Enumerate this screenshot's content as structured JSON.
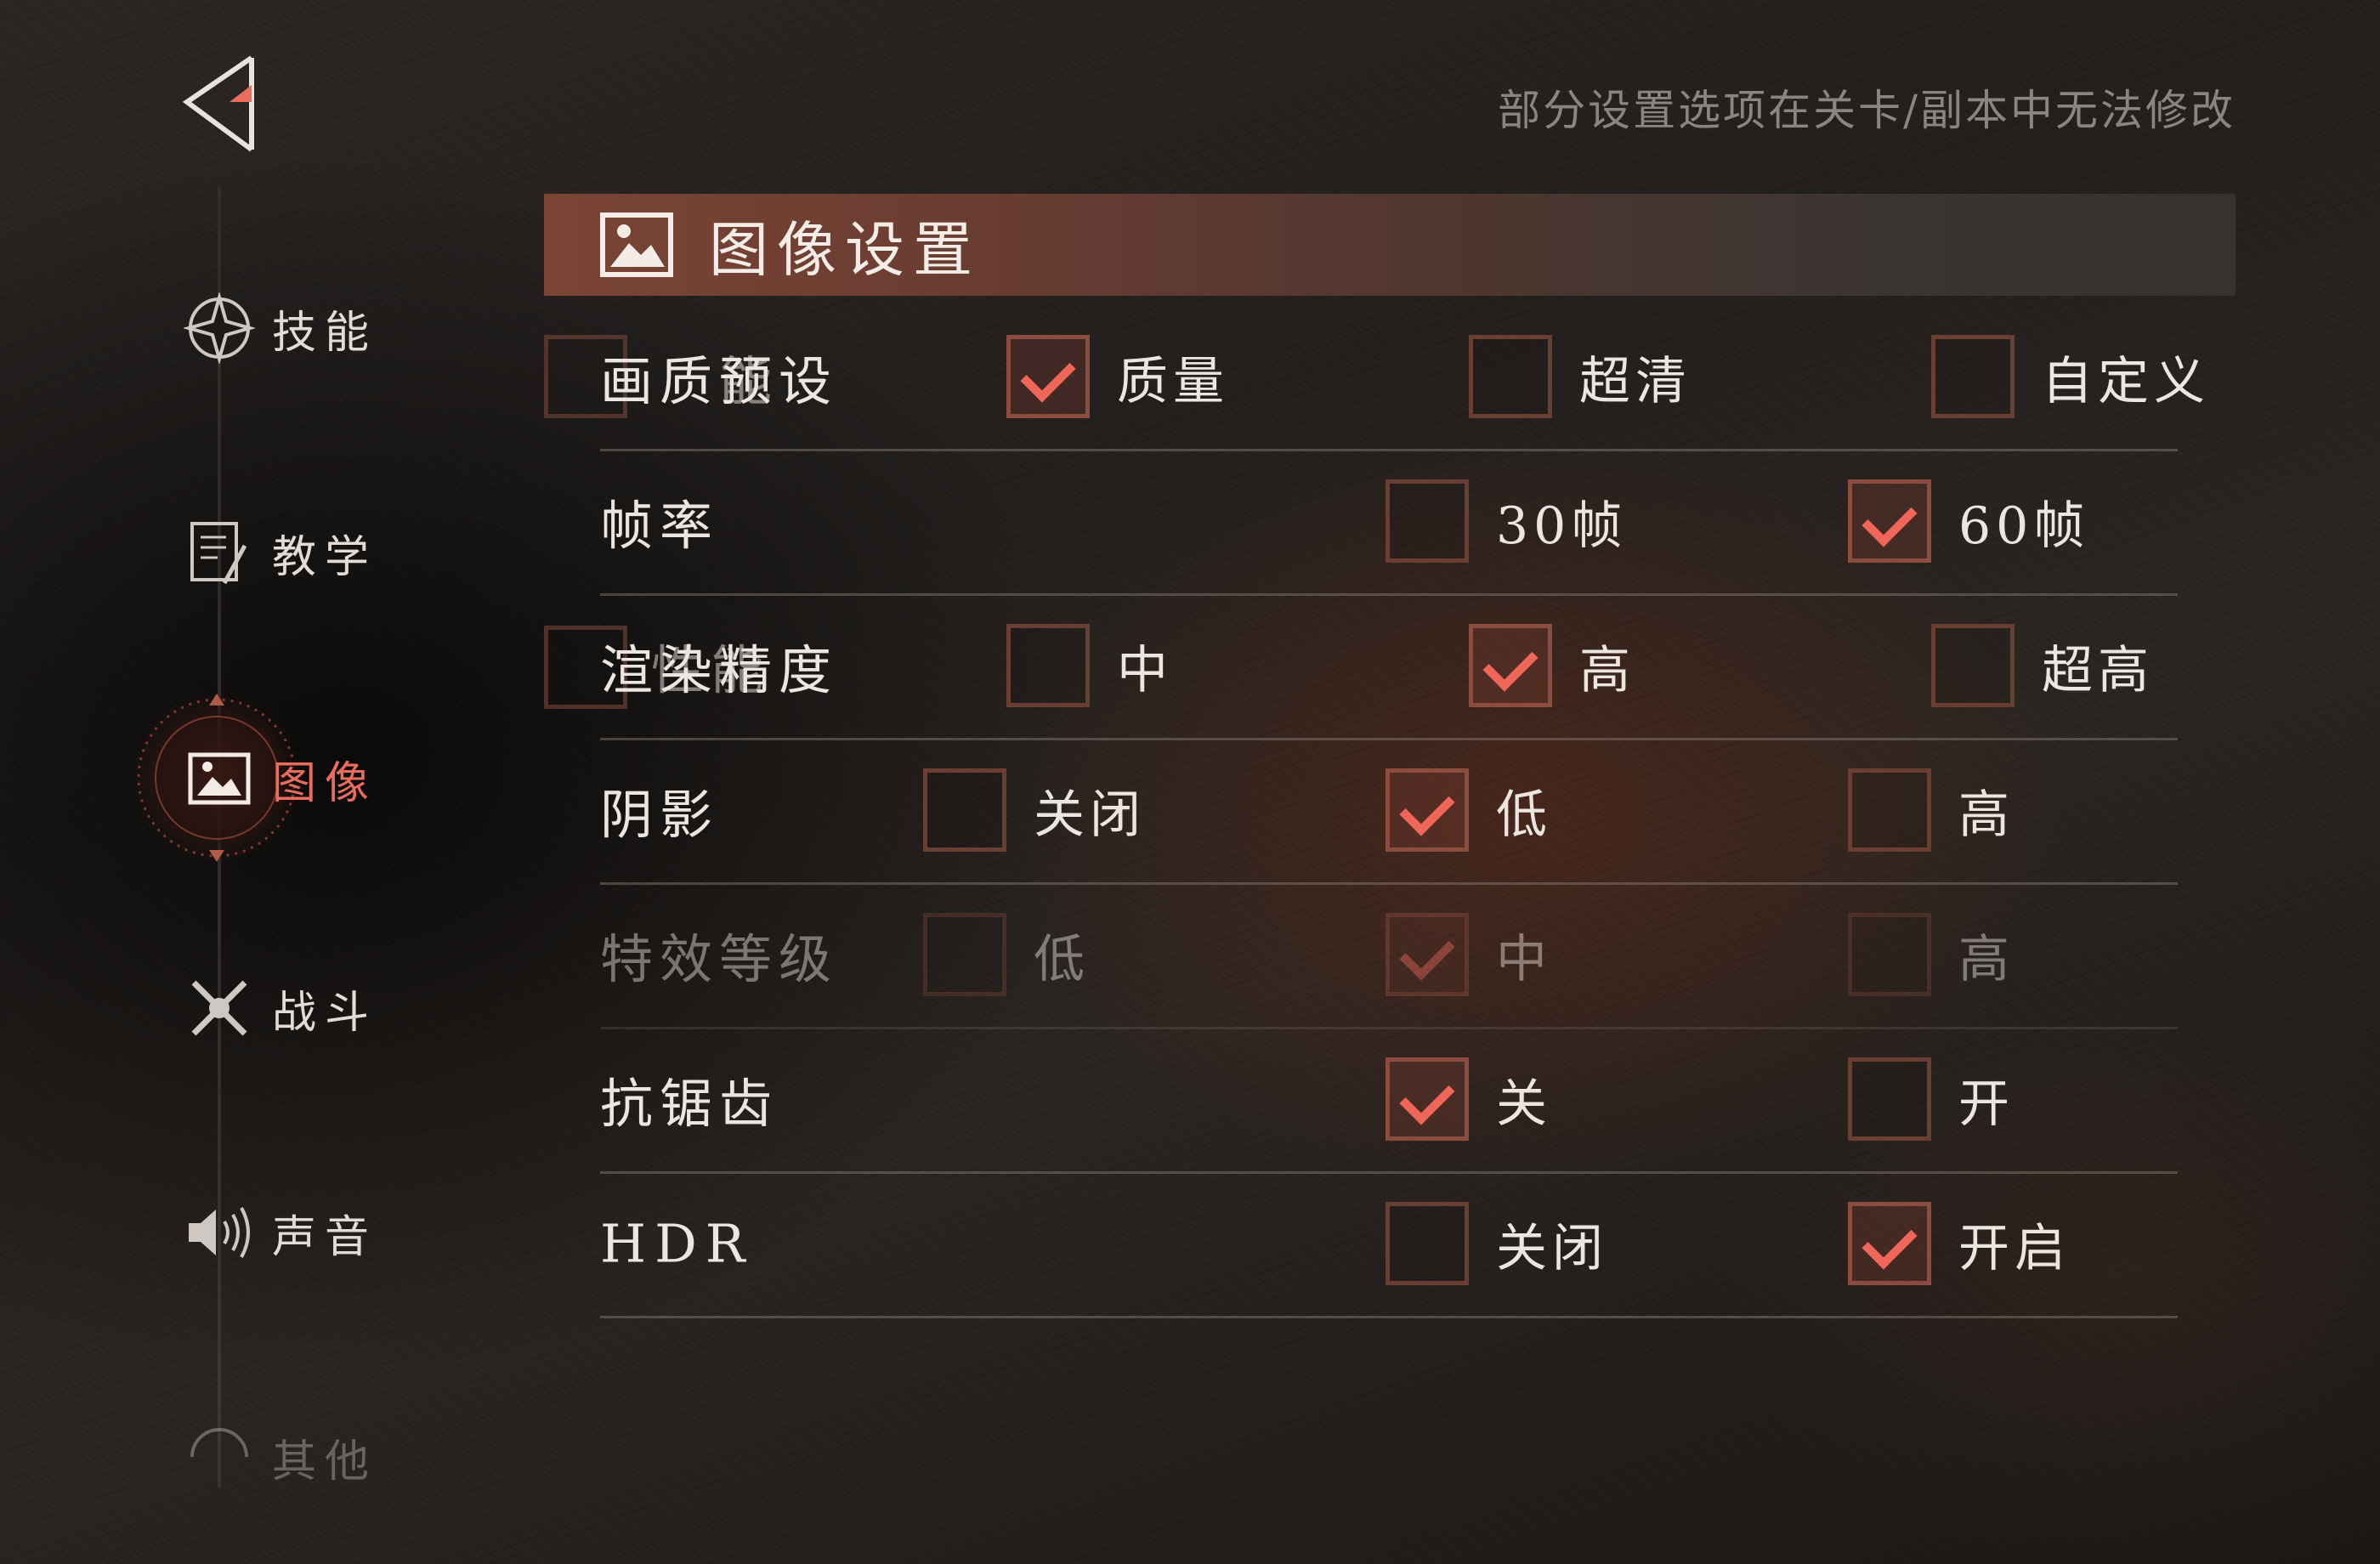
{
  "notice": "部分设置选项在关卡/副本中无法修改",
  "section": {
    "title": "图像设置",
    "icon": "image-icon"
  },
  "sidebar": {
    "items": [
      {
        "label": "技能",
        "icon": "compass-star-icon",
        "active": false
      },
      {
        "label": "教学",
        "icon": "notebook-pen-icon",
        "active": false
      },
      {
        "label": "图像",
        "icon": "image-icon",
        "active": true
      },
      {
        "label": "战斗",
        "icon": "crossed-swords-icon",
        "active": false
      },
      {
        "label": "声音",
        "icon": "speaker-icon",
        "active": false
      },
      {
        "label": "其他",
        "icon": "circle-icon",
        "active": false
      }
    ]
  },
  "colors": {
    "accent": "#e96c5c",
    "checkbox_border": "#6b3e33",
    "header_start": "#7a4434"
  },
  "settings": [
    {
      "label": "画质预设",
      "overlay": "质能",
      "options": [
        {
          "label": "质量",
          "checked": true
        },
        {
          "label": "超清",
          "checked": false
        },
        {
          "label": "自定义",
          "checked": false
        }
      ]
    },
    {
      "label": "帧率",
      "options": [
        {
          "label": "30帧",
          "checked": false
        },
        {
          "label": "60帧",
          "checked": true
        }
      ]
    },
    {
      "label": "渲染精度",
      "overlay": "性能",
      "options": [
        {
          "label": "中",
          "checked": false
        },
        {
          "label": "高",
          "checked": true
        },
        {
          "label": "超高",
          "checked": false
        }
      ]
    },
    {
      "label": "阴影",
      "options": [
        {
          "label": "关闭",
          "checked": false
        },
        {
          "label": "低",
          "checked": true
        },
        {
          "label": "高",
          "checked": false
        }
      ]
    },
    {
      "label": "特效等级",
      "disabled": true,
      "options": [
        {
          "label": "低",
          "checked": false
        },
        {
          "label": "中",
          "checked": true
        },
        {
          "label": "高",
          "checked": false
        }
      ]
    },
    {
      "label": "抗锯齿",
      "options": [
        {
          "label": "关",
          "checked": true
        },
        {
          "label": "开",
          "checked": false
        }
      ]
    },
    {
      "label": "HDR",
      "options": [
        {
          "label": "关闭",
          "checked": false
        },
        {
          "label": "开启",
          "checked": true
        }
      ]
    }
  ]
}
